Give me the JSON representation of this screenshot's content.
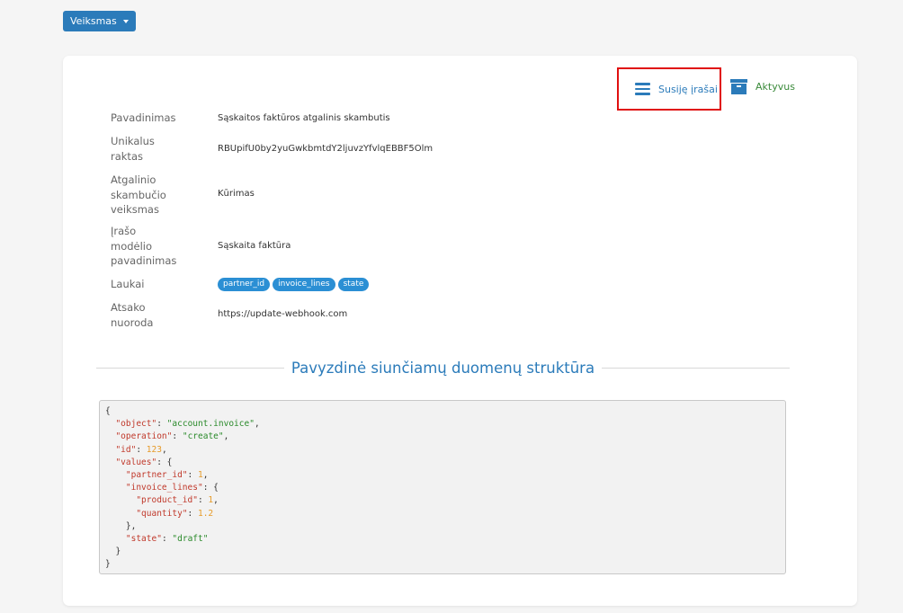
{
  "toolbar": {
    "action_label": "Veiksmas"
  },
  "smart_buttons": {
    "related": "Susiję įrašai",
    "active": "Aktyvus"
  },
  "fields": [
    {
      "label": "Pavadinimas",
      "value": "Sąskaitos faktūros atgalinis skambutis"
    },
    {
      "label": "Unikalus raktas",
      "value": "RBUpifU0by2yuGwkbmtdY2ljuvzYfvlqEBBF5Olm"
    },
    {
      "label": "Atgalinio skambučio veiksmas",
      "value": "Kūrimas"
    },
    {
      "label": "Įrašo modėlio pavadinimas",
      "value": "Sąskaita faktūra"
    },
    {
      "label": "Laukai",
      "tags": [
        "partner_id",
        "invoice_lines",
        "state"
      ]
    },
    {
      "label": "Atsako nuoroda",
      "value": "https://update-webhook.com"
    }
  ],
  "labels": {
    "l0": [
      "Pavadinimas"
    ],
    "l1": [
      "Unikalus",
      "raktas"
    ],
    "l2": [
      "Atgalinio",
      "skambučio",
      "veiksmas"
    ],
    "l3": [
      "Įrašo",
      "modėlio",
      "pavadinimas"
    ],
    "l4": [
      "Laukai"
    ],
    "l5": [
      "Atsako",
      "nuoroda"
    ]
  },
  "section_title": "Pavyzdinė siunčiamų duomenų struktūra",
  "code_sample": {
    "object": "account.invoice",
    "operation": "create",
    "id": 123,
    "values": {
      "partner_id": 1,
      "invoice_lines": {
        "product_id": 1,
        "quantity": 1.2
      },
      "state": "draft"
    }
  },
  "colors": {
    "primary": "#2b7bba",
    "tag": "#2b8fd4",
    "highlight_border": "#e01010",
    "active": "#3a8a3a"
  }
}
